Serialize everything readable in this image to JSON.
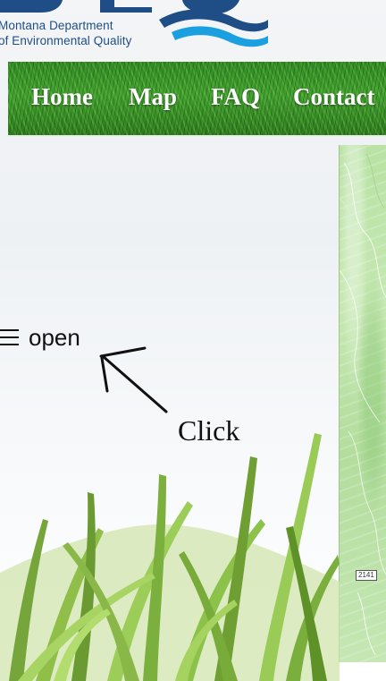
{
  "logo": {
    "line1": "Montana Department",
    "line2": "of Environmental Quality",
    "icon": "deq-wave-logo"
  },
  "nav": {
    "items": [
      {
        "label": "Home"
      },
      {
        "label": "Map"
      },
      {
        "label": "FAQ"
      },
      {
        "label": "Contact"
      }
    ]
  },
  "menu": {
    "toggle_label": "open",
    "icon": "hamburger-icon"
  },
  "annotation": {
    "label": "Click",
    "icon": "arrow-icon"
  },
  "map": {
    "road_label": "2141"
  },
  "colors": {
    "logo_blue": "#1f4e86",
    "nav_green": "#3f9f2c",
    "map_green": "#bfe5aa"
  }
}
